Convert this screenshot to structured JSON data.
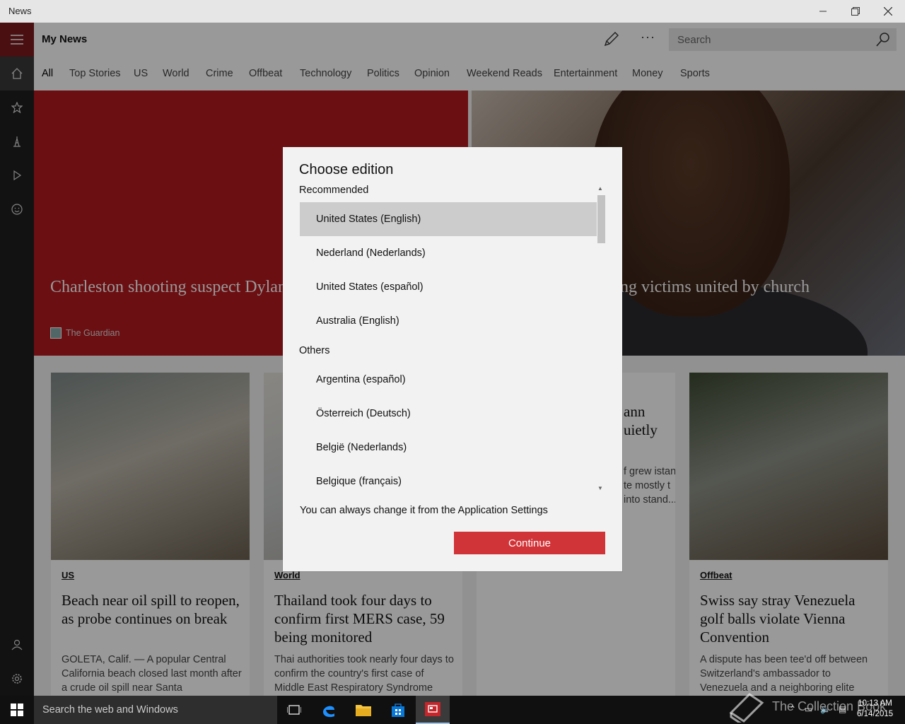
{
  "window": {
    "title": "News"
  },
  "topbar": {
    "title": "My News",
    "more_label": "···",
    "search_placeholder": "Search"
  },
  "tabs": [
    "All",
    "Top Stories",
    "US",
    "World",
    "Crime",
    "Offbeat",
    "Technology",
    "Politics",
    "Opinion",
    "Weekend Reads",
    "Entertainment",
    "Money",
    "Sports"
  ],
  "hero": {
    "left_headline": "Charleston shooting suspect Dylann Roof 'wanted to ignite civil war'",
    "left_source": "The Guardian",
    "right_headline": "ng victims united by church"
  },
  "cards": [
    {
      "category": "US",
      "headline": "Beach near oil spill to reopen, as probe continues on break",
      "summary": "GOLETA, Calif. — A popular Central California beach closed last month after a crude oil spill near Santa"
    },
    {
      "category": "World",
      "headline": "Thailand took four days to confirm first MERS case, 59 being monitored",
      "summary": "Thai authorities took nearly four days to confirm the country's first case of Middle East Respiratory Syndrome"
    },
    {
      "category": "",
      "headline": "ann uietly",
      "summary": "f grew istant te mostly t into stand..."
    },
    {
      "category": "Offbeat",
      "headline": "Swiss say stray Venezuela golf balls violate Vienna Convention",
      "summary": "A dispute has been tee'd off between Switzerland's ambassador to Venezuela and a neighboring elite"
    }
  ],
  "dialog": {
    "title": "Choose edition",
    "recommended_label": "Recommended",
    "recommended": [
      "United States (English)",
      "Nederland (Nederlands)",
      "United States (español)",
      "Australia (English)"
    ],
    "others_label": "Others",
    "others": [
      "Argentina (español)",
      "Österreich (Deutsch)",
      "België (Nederlands)",
      "Belgique (français)"
    ],
    "selected": "United States (English)",
    "note": "You can always change it from the Application Settings",
    "continue_label": "Continue"
  },
  "taskbar": {
    "search_placeholder": "Search the web and Windows",
    "watermark": "The Collection Book",
    "time": "10:13 AM",
    "date": "6/14/2015"
  },
  "colors": {
    "accent_red": "#d13438",
    "rail_menu": "#7a1a1d",
    "hero_red": "#b3191f"
  }
}
